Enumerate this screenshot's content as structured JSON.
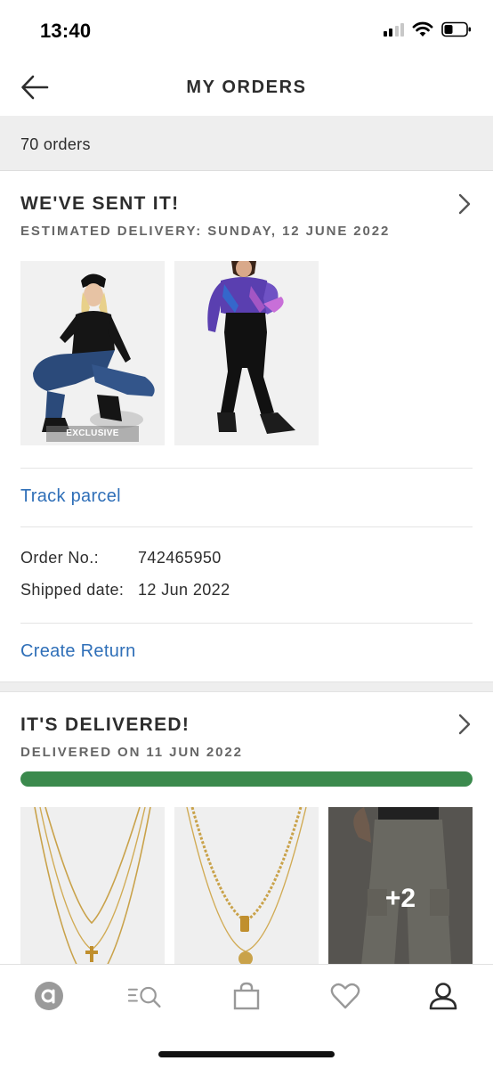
{
  "status_bar": {
    "time": "13:40"
  },
  "header": {
    "title": "MY ORDERS"
  },
  "orders_count": "70 orders",
  "orders": [
    {
      "status_title": "WE'VE SENT IT!",
      "status_subtitle": "ESTIMATED DELIVERY: SUNDAY, 12 JUNE 2022",
      "items": [
        {
          "icon": "model-black-tee-denim-image",
          "badge": "EXCLUSIVE"
        },
        {
          "icon": "model-purple-top-leggings-image"
        }
      ],
      "track_link": "Track parcel",
      "order_no_label": "Order No.:",
      "order_no": "742465950",
      "shipped_label": "Shipped date:",
      "shipped_date": "12 Jun 2022",
      "return_link": "Create Return"
    },
    {
      "status_title": "IT'S DELIVERED!",
      "status_subtitle": "DELIVERED ON 11 JUN 2022",
      "progress": 1.0,
      "items": [
        {
          "icon": "cross-necklace-image"
        },
        {
          "icon": "coin-necklace-image"
        },
        {
          "icon": "cargo-trousers-image",
          "more": "+2"
        }
      ]
    }
  ],
  "tabbar": {
    "items": [
      "home-icon",
      "search-icon",
      "bag-icon",
      "heart-icon",
      "account-icon"
    ],
    "active": "account-icon"
  },
  "colors": {
    "link": "#2f6fb8",
    "progress": "#3b8a4d",
    "text": "#2d2d2d",
    "subtext": "#666666"
  }
}
